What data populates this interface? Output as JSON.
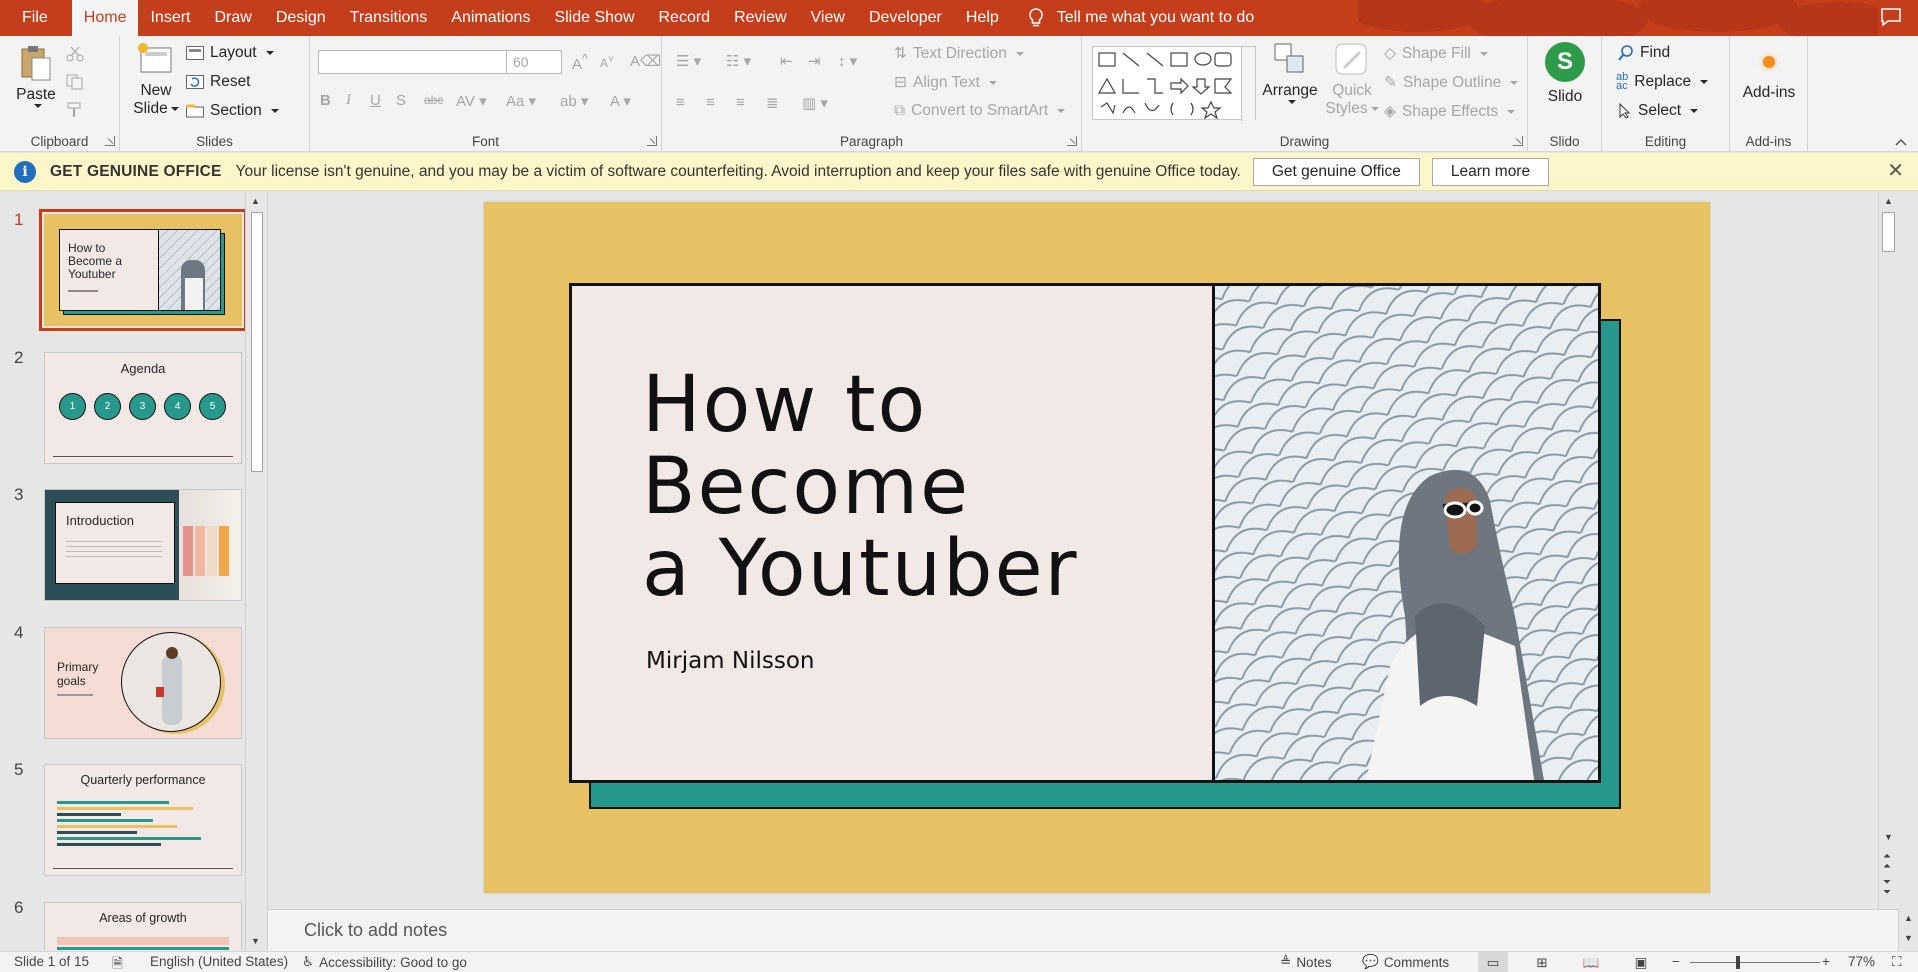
{
  "tabs": [
    {
      "label": "File"
    },
    {
      "label": "Home"
    },
    {
      "label": "Insert"
    },
    {
      "label": "Draw"
    },
    {
      "label": "Design"
    },
    {
      "label": "Transitions"
    },
    {
      "label": "Animations"
    },
    {
      "label": "Slide Show"
    },
    {
      "label": "Record"
    },
    {
      "label": "Review"
    },
    {
      "label": "View"
    },
    {
      "label": "Developer"
    },
    {
      "label": "Help"
    }
  ],
  "active_tab": "Home",
  "tell_me": "Tell me what you want to do",
  "ribbon": {
    "clipboard": {
      "label": "Clipboard",
      "paste": "Paste"
    },
    "slides": {
      "label": "Slides",
      "new_slide_1": "New",
      "new_slide_2": "Slide",
      "layout": "Layout",
      "reset": "Reset",
      "section": "Section"
    },
    "font": {
      "label": "Font",
      "size": "60"
    },
    "paragraph": {
      "label": "Paragraph",
      "text_direction": "Text Direction",
      "align_text": "Align Text",
      "convert_smartart": "Convert to SmartArt"
    },
    "drawing": {
      "label": "Drawing",
      "arrange": "Arrange",
      "quick_styles_1": "Quick",
      "quick_styles_2": "Styles",
      "shape_fill": "Shape Fill",
      "shape_outline": "Shape Outline",
      "shape_effects": "Shape Effects"
    },
    "slido": {
      "label": "Slido",
      "button": "Slido"
    },
    "editing": {
      "label": "Editing",
      "find": "Find",
      "replace": "Replace",
      "select": "Select"
    },
    "addins": {
      "label": "Add-ins",
      "button": "Add-ins"
    }
  },
  "notification": {
    "title": "GET GENUINE OFFICE",
    "message": "Your license isn't genuine, and you may be a victim of software counterfeiting. Avoid interruption and keep your files safe with genuine Office today.",
    "btn_genuine": "Get genuine Office",
    "btn_learn": "Learn more"
  },
  "thumbnails": {
    "numbers": [
      "1",
      "2",
      "3",
      "4",
      "5",
      "6"
    ],
    "t1_title": "How to Become a Youtuber",
    "t2_title": "Agenda",
    "t2_circles": [
      "1",
      "2",
      "3",
      "4",
      "5"
    ],
    "t3_title": "Introduction",
    "t4_title": "Primary goals",
    "t5_title": "Quarterly performance",
    "t6_title": "Areas of growth"
  },
  "slide": {
    "title": "How to\nBecome\na Youtuber",
    "author": "Mirjam Nilsson"
  },
  "notes_placeholder": "Click to add notes",
  "status": {
    "slide_info": "Slide 1 of 15",
    "language": "English (United States)",
    "accessibility": "Accessibility: Good to go",
    "notes": "Notes",
    "comments": "Comments",
    "zoom": "77%"
  },
  "colors": {
    "accent": "#c43e1c",
    "slide_bg": "#e6c264",
    "teal": "#26998c",
    "card": "#f2e9e7"
  }
}
